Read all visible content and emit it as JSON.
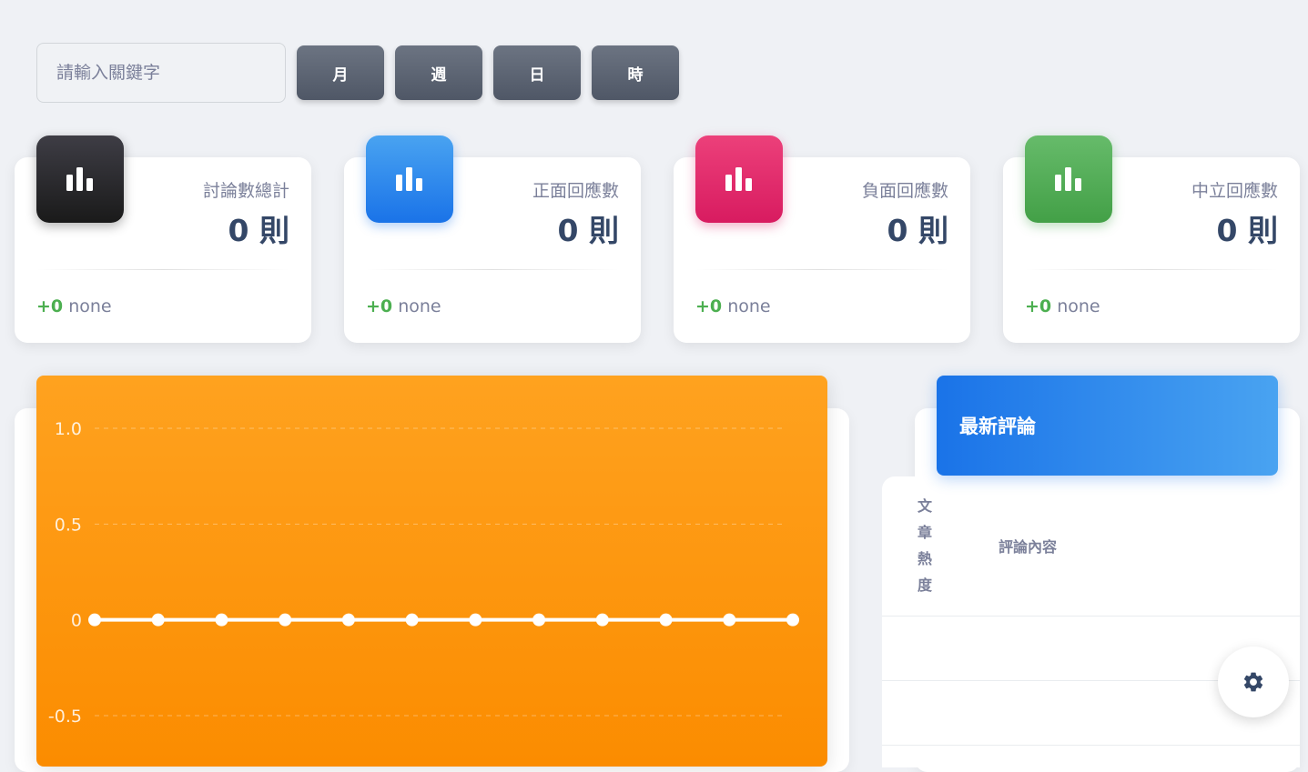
{
  "search": {
    "placeholder": "請輸入關鍵字"
  },
  "filters": [
    {
      "label": "月"
    },
    {
      "label": "週"
    },
    {
      "label": "日"
    },
    {
      "label": "時"
    }
  ],
  "cards": [
    {
      "title": "討論數總計",
      "value": "0 則",
      "delta": "+0",
      "note": "none",
      "icon": "bar-chart-icon",
      "color": "#262626"
    },
    {
      "title": "正面回應數",
      "value": "0 則",
      "delta": "+0",
      "note": "none",
      "icon": "bar-chart-icon",
      "color": "#1a73e8"
    },
    {
      "title": "負面回應數",
      "value": "0 則",
      "delta": "+0",
      "note": "none",
      "icon": "bar-chart-icon",
      "color": "#d81b60"
    },
    {
      "title": "中立回應數",
      "value": "0 則",
      "delta": "+0",
      "note": "none",
      "icon": "bar-chart-icon",
      "color": "#43a047"
    }
  ],
  "chart_data": {
    "type": "line",
    "background": "#fb8c00",
    "line_color": "#ffffff",
    "grid": true,
    "y_ticks": [
      "1.0",
      "0.5",
      "0",
      "-0.5"
    ],
    "ylim": [
      -0.5,
      1.0
    ],
    "series": [
      {
        "values": [
          0,
          0,
          0,
          0,
          0,
          0,
          0,
          0,
          0,
          0,
          0,
          0
        ]
      }
    ]
  },
  "comments": {
    "title": "最新評論",
    "col_heat": "文章熱度",
    "col_content": "評論內容"
  },
  "fab": {
    "icon": "gear-icon"
  }
}
